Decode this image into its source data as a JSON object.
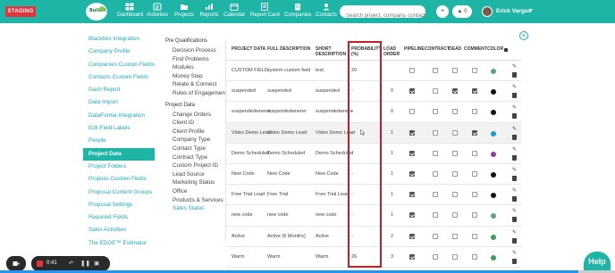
{
  "topbar": {
    "env_badge": "STAGING",
    "logo_text": "BuildIt",
    "nav": [
      {
        "label": "Dashboard",
        "icon": "dashboard-icon"
      },
      {
        "label": "Activities",
        "icon": "activities-icon"
      },
      {
        "label": "Projects",
        "icon": "projects-icon"
      },
      {
        "label": "Reports",
        "icon": "reports-icon"
      },
      {
        "label": "Calendar",
        "icon": "calendar-icon"
      },
      {
        "label": "Report Card",
        "icon": "report-card-icon"
      },
      {
        "label": "Companies",
        "icon": "companies-icon"
      },
      {
        "label": "Contacts",
        "icon": "contacts-icon"
      }
    ],
    "search_placeholder": "Search project, company, contact",
    "add_symbol": "+",
    "notifications_count": "0",
    "user_name": "Erick Vargas"
  },
  "sidebar": {
    "items": [
      "Blackbox Integration",
      "Company Profile",
      "Companies Custom Fields",
      "Contacts Custom Fields",
      "Dash Report",
      "Data Import",
      "DataForma Integration",
      "Edit Field Labels",
      "People",
      "Project Data",
      "Project Folders",
      "Projects Custom Fields",
      "Proposal Content Groups",
      "Proposal Settings",
      "Required Fields",
      "Sales Activities",
      "The EDGE™ Estimator"
    ],
    "active_index": 9
  },
  "submenu": {
    "pre_qual_heading": "Pre Qualifications",
    "pre_qual_items": [
      "Decision Process",
      "Find Problems",
      "Modules",
      "Money Step",
      "Relate & Connect",
      "Rules of Engagement"
    ],
    "project_data_heading": "Project Data",
    "project_data_items": [
      "Change Orders",
      "Client ID",
      "Client Profile",
      "Company Type",
      "Contact Type",
      "Contract Type",
      "Custom Project ID",
      "Lead Source",
      "Marketing Status",
      "Office",
      "Products & Services",
      "Sales Status"
    ],
    "active_item": "Sales Status"
  },
  "table": {
    "headers": {
      "project_data": "PROJECT DATA",
      "full_description": "FULL DESCRIPTION",
      "short_description_1": "SHORT",
      "short_description_2": "DESCRIPTION",
      "probability_1": "PROBABILITY",
      "probability_2": "(%)",
      "load_order_1": "LOAD",
      "load_order_2": "ORDER",
      "pipeline": "PIPELINE",
      "contract": "CONTRACT",
      "dead": "DEAD",
      "comment": "COMMENT",
      "color": "COLOR"
    },
    "rows": [
      {
        "project_data": "CUSTOM FIELD",
        "full": "system custom field",
        "short": "test",
        "prob": "20",
        "load": "",
        "pipeline": false,
        "contract": false,
        "dead": false,
        "comment": false,
        "color": "#5fa37a"
      },
      {
        "project_data": "suspended",
        "full": "suspended",
        "short": "suspended",
        "prob": "-",
        "load": "0",
        "pipeline": true,
        "contract": false,
        "dead": true,
        "comment": true,
        "color": "#111111"
      },
      {
        "project_data": "suspendedwnerer",
        "full": "suspendedwnerer",
        "short": "suspendedwnere",
        "prob": "-",
        "load": "0",
        "pipeline": false,
        "contract": false,
        "dead": false,
        "comment": false,
        "color": "#111111"
      },
      {
        "project_data": "Video Demo Lead",
        "full": "Video Demo Lead",
        "short": "Video Demo Lead",
        "prob": "-",
        "load": "1",
        "pipeline": true,
        "contract": false,
        "dead": false,
        "comment": true,
        "color": "#1e9bd7"
      },
      {
        "project_data": "Demo Scheduled",
        "full": "Demo Scheduled",
        "short": "Demo Scheduled",
        "prob": "-",
        "load": "1",
        "pipeline": true,
        "contract": false,
        "dead": false,
        "comment": false,
        "color": "#8a3ea8"
      },
      {
        "project_data": "New Code",
        "full": "New Code",
        "short": "New Code",
        "prob": "-",
        "load": "1",
        "pipeline": true,
        "contract": false,
        "dead": false,
        "comment": false,
        "color": "#111111"
      },
      {
        "project_data": "Free Trial Lead",
        "full": "Free Trial",
        "short": "Free Trial Lead",
        "prob": "-",
        "load": "1",
        "pipeline": true,
        "contract": false,
        "dead": false,
        "comment": false,
        "color": "#111111"
      },
      {
        "project_data": "new code",
        "full": "new code",
        "short": "new code",
        "prob": "-",
        "load": "1",
        "pipeline": true,
        "contract": false,
        "dead": false,
        "comment": false,
        "color": "#5fa37a"
      },
      {
        "project_data": "Active",
        "full": "Active (6 Months)",
        "short": "Active",
        "prob": "-",
        "load": "2",
        "pipeline": true,
        "contract": false,
        "dead": false,
        "comment": false,
        "color": "#3f9a5a"
      },
      {
        "project_data": "Warm",
        "full": "Warm",
        "short": "Warm",
        "prob": "26",
        "load": "3",
        "pipeline": true,
        "contract": false,
        "dead": false,
        "comment": false,
        "color": "#3f9a5a"
      }
    ]
  },
  "recorder": {
    "time": "0:41"
  },
  "help_label": "Help",
  "progress_fraction": 0.94,
  "colors": {
    "brand_teal": "#1fb5a6",
    "link_teal": "#1fa8b8",
    "highlight_red": "#c41e2a",
    "staging_red": "#e0353d"
  }
}
